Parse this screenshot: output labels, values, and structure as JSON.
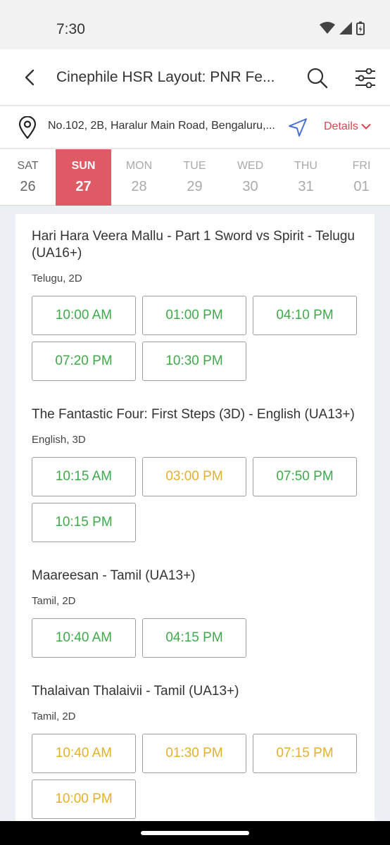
{
  "status_bar": {
    "time": "7:30"
  },
  "app_bar": {
    "title": "Cinephile HSR Layout: PNR Fe..."
  },
  "venue": {
    "address": "No.102, 2B, Haralur Main Road, Bengaluru,...",
    "details_label": "Details"
  },
  "dates": [
    {
      "dow": "SAT",
      "dom": "26",
      "state": "past"
    },
    {
      "dow": "SUN",
      "dom": "27",
      "state": "selected"
    },
    {
      "dow": "MON",
      "dom": "28",
      "state": "future"
    },
    {
      "dow": "TUE",
      "dom": "29",
      "state": "future"
    },
    {
      "dow": "WED",
      "dom": "30",
      "state": "future"
    },
    {
      "dow": "THU",
      "dom": "31",
      "state": "future"
    },
    {
      "dow": "FRI",
      "dom": "01",
      "state": "future"
    }
  ],
  "movies": [
    {
      "title": "Hari Hara Veera Mallu - Part 1 Sword vs Spirit - Telugu (UA16+)",
      "format": "Telugu, 2D",
      "showtimes": [
        {
          "time": "10:00 AM",
          "status": "available"
        },
        {
          "time": "01:00 PM",
          "status": "available"
        },
        {
          "time": "04:10 PM",
          "status": "available"
        },
        {
          "time": "07:20 PM",
          "status": "available"
        },
        {
          "time": "10:30 PM",
          "status": "available"
        }
      ]
    },
    {
      "title": "The Fantastic Four: First Steps (3D) - English (UA13+)",
      "format": "English, 3D",
      "showtimes": [
        {
          "time": "10:15 AM",
          "status": "available"
        },
        {
          "time": "03:00 PM",
          "status": "filling"
        },
        {
          "time": "07:50 PM",
          "status": "available"
        },
        {
          "time": "10:15 PM",
          "status": "available"
        }
      ]
    },
    {
      "title": "Maareesan - Tamil (UA13+)",
      "format": "Tamil, 2D",
      "showtimes": [
        {
          "time": "10:40 AM",
          "status": "available"
        },
        {
          "time": "04:15 PM",
          "status": "available"
        }
      ]
    },
    {
      "title": "Thalaivan Thalaivii - Tamil (UA13+)",
      "format": "Tamil, 2D",
      "showtimes": [
        {
          "time": "10:40 AM",
          "status": "filling"
        },
        {
          "time": "01:30 PM",
          "status": "filling"
        },
        {
          "time": "07:15 PM",
          "status": "filling"
        },
        {
          "time": "10:00 PM",
          "status": "filling"
        }
      ]
    }
  ],
  "colors": {
    "accent": "#e05a66",
    "available": "#3faa4a",
    "filling": "#e5b02a",
    "details": "#d9434f",
    "nav_icon": "#4a6fd6"
  },
  "icons": {
    "back": "arrow-left-icon",
    "search": "search-icon",
    "filter": "sliders-icon",
    "location": "map-pin-icon",
    "navigate": "navigation-arrow-icon",
    "details": "chevron-down-icon"
  }
}
